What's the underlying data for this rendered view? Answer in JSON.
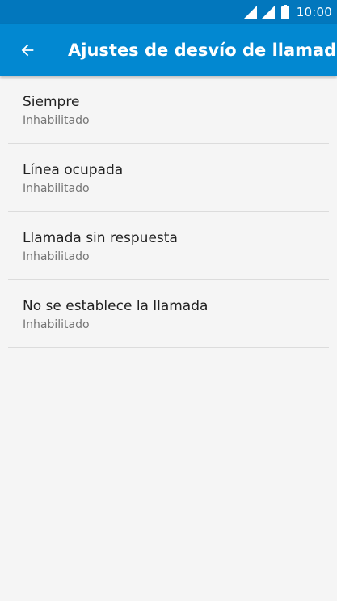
{
  "status_bar": {
    "time": "10:00",
    "icons": [
      "signal-icon",
      "signal-icon",
      "battery-icon"
    ]
  },
  "app_bar": {
    "back_icon": "arrow-left-icon",
    "title": "Ajustes de desvío de llamada"
  },
  "items": [
    {
      "title": "Siempre",
      "summary": "Inhabilitado"
    },
    {
      "title": "Línea ocupada",
      "summary": "Inhabilitado"
    },
    {
      "title": "Llamada sin respuesta",
      "summary": "Inhabilitado"
    },
    {
      "title": "No se establece la llamada",
      "summary": "Inhabilitado"
    }
  ],
  "colors": {
    "status_bar": "#0277bd",
    "app_bar": "#0288d1",
    "background": "#f5f5f5"
  }
}
